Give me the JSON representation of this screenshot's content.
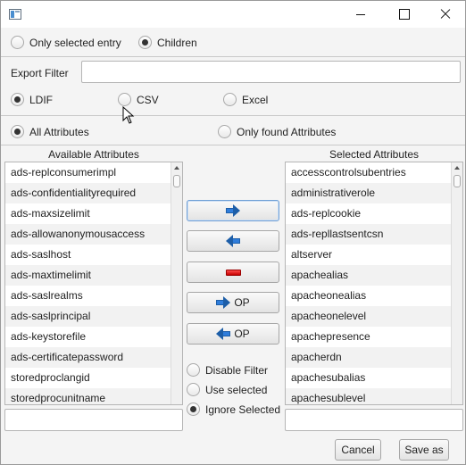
{
  "window": {
    "title": ""
  },
  "scope": {
    "options": [
      {
        "label": "Only selected entry",
        "checked": false
      },
      {
        "label": "Children",
        "checked": true
      }
    ]
  },
  "export_filter": {
    "label": "Export Filter",
    "value": ""
  },
  "format": {
    "options": [
      {
        "label": "LDIF",
        "checked": true
      },
      {
        "label": "CSV",
        "checked": false
      },
      {
        "label": "Excel",
        "checked": false
      }
    ]
  },
  "attribute_mode": {
    "options": [
      {
        "label": "All Attributes",
        "checked": true
      },
      {
        "label": "Only found Attributes",
        "checked": false
      }
    ]
  },
  "available": {
    "heading": "Available Attributes",
    "items": [
      "ads-replconsumerimpl",
      "ads-confidentialityrequired",
      "ads-maxsizelimit",
      "ads-allowanonymousaccess",
      "ads-saslhost",
      "ads-maxtimelimit",
      "ads-saslrealms",
      "ads-saslprincipal",
      "ads-keystorefile",
      "ads-certificatepassword",
      "storedproclangid",
      "storedprocunitname"
    ],
    "filter_value": ""
  },
  "selected": {
    "heading": "Selected Attributes",
    "items": [
      "accesscontrolsubentries",
      "administrativerole",
      "ads-replcookie",
      "ads-repllastsentcsn",
      "altserver",
      "apachealias",
      "apacheonealias",
      "apacheonelevel",
      "apachepresence",
      "apacherdn",
      "apachesubalias",
      "apachesublevel"
    ],
    "filter_value": ""
  },
  "transfer_buttons": {
    "op_label": "OP"
  },
  "filter_mode": {
    "options": [
      {
        "label": "Disable Filter",
        "checked": false
      },
      {
        "label": "Use selected",
        "checked": false
      },
      {
        "label": "Ignore Selected",
        "checked": true
      }
    ]
  },
  "footer": {
    "cancel_label": "Cancel",
    "save_label": "Save as"
  }
}
